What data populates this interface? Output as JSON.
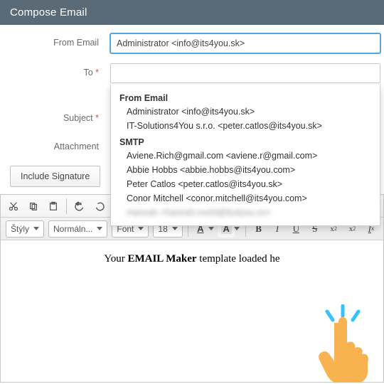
{
  "header": {
    "title": "Compose Email"
  },
  "labels": {
    "fromEmail": "From Email",
    "to": "To",
    "subject": "Subject",
    "attachment": "Attachment"
  },
  "required_marker": "*",
  "from_value": "Administrator <info@its4you.sk>",
  "include_signature_label": "Include Signature",
  "dropdown": {
    "groups": [
      {
        "header": "From Email",
        "items": [
          "Administrator <info@its4you.sk>",
          "IT-Solutions4You s.r.o. <peter.catlos@its4you.sk>"
        ]
      },
      {
        "header": "SMTP",
        "items": [
          "Aviene.Rich@gmail.com <aviene.r@gmail.com>",
          "Abbie Hobbs <abbie.hobbs@its4you.com>",
          "Peter Catlos <peter.catlos@its4you.sk>",
          "Conor Mitchell <conor.mitchell@its4you.com>"
        ],
        "blurred_tail": "Hannah <hannah.mohl@its4you.sn>"
      }
    ]
  },
  "toolbar": {
    "combos": {
      "styles": "Štýly",
      "format": "Normáln...",
      "font": "Font",
      "size": "18"
    },
    "split_buttons": {
      "textcolor": "A",
      "backcolor": "A"
    },
    "buttons": {
      "bold": "B",
      "italic": "I",
      "underline": "U",
      "strike": "S"
    }
  },
  "body": {
    "prefix": "Your ",
    "strong": "EMAIL Maker",
    "suffix": " template loaded he"
  }
}
